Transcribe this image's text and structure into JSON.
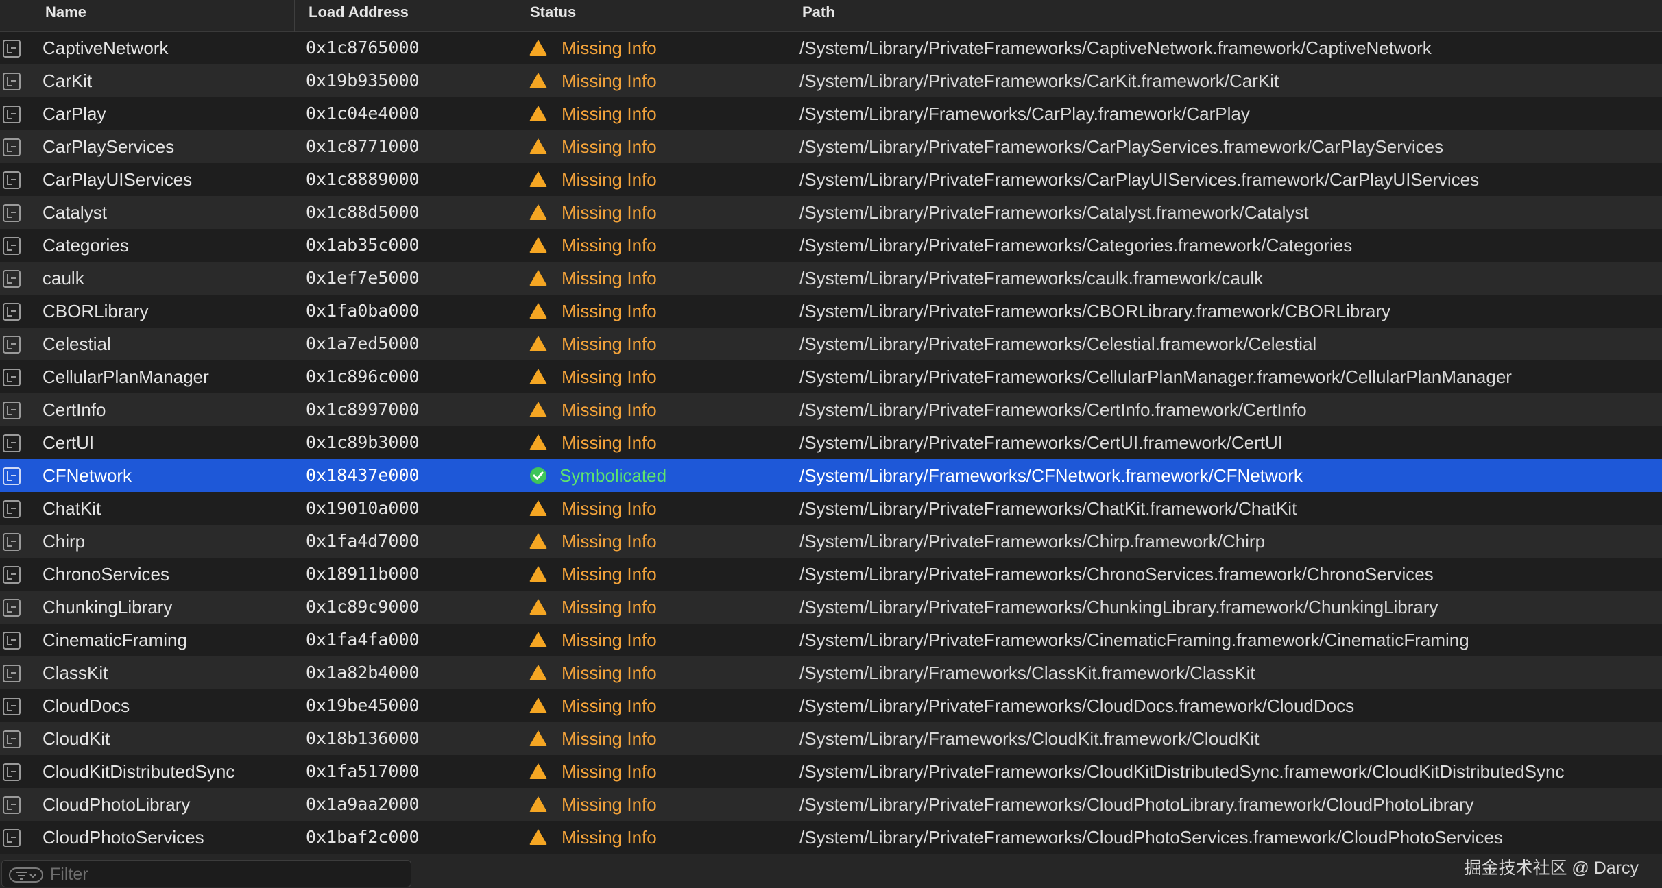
{
  "columns": {
    "name": "Name",
    "load_address": "Load Address",
    "status": "Status",
    "path": "Path"
  },
  "rows": [
    {
      "name": "CaptiveNetwork",
      "address": "0x1c8765000",
      "status": "Missing Info",
      "path": "/System/Library/PrivateFrameworks/CaptiveNetwork.framework/CaptiveNetwork"
    },
    {
      "name": "CarKit",
      "address": "0x19b935000",
      "status": "Missing Info",
      "path": "/System/Library/PrivateFrameworks/CarKit.framework/CarKit"
    },
    {
      "name": "CarPlay",
      "address": "0x1c04e4000",
      "status": "Missing Info",
      "path": "/System/Library/Frameworks/CarPlay.framework/CarPlay"
    },
    {
      "name": "CarPlayServices",
      "address": "0x1c8771000",
      "status": "Missing Info",
      "path": "/System/Library/PrivateFrameworks/CarPlayServices.framework/CarPlayServices"
    },
    {
      "name": "CarPlayUIServices",
      "address": "0x1c8889000",
      "status": "Missing Info",
      "path": "/System/Library/PrivateFrameworks/CarPlayUIServices.framework/CarPlayUIServices"
    },
    {
      "name": "Catalyst",
      "address": "0x1c88d5000",
      "status": "Missing Info",
      "path": "/System/Library/PrivateFrameworks/Catalyst.framework/Catalyst"
    },
    {
      "name": "Categories",
      "address": "0x1ab35c000",
      "status": "Missing Info",
      "path": "/System/Library/PrivateFrameworks/Categories.framework/Categories"
    },
    {
      "name": "caulk",
      "address": "0x1ef7e5000",
      "status": "Missing Info",
      "path": "/System/Library/PrivateFrameworks/caulk.framework/caulk"
    },
    {
      "name": "CBORLibrary",
      "address": "0x1fa0ba000",
      "status": "Missing Info",
      "path": "/System/Library/PrivateFrameworks/CBORLibrary.framework/CBORLibrary"
    },
    {
      "name": "Celestial",
      "address": "0x1a7ed5000",
      "status": "Missing Info",
      "path": "/System/Library/PrivateFrameworks/Celestial.framework/Celestial"
    },
    {
      "name": "CellularPlanManager",
      "address": "0x1c896c000",
      "status": "Missing Info",
      "path": "/System/Library/PrivateFrameworks/CellularPlanManager.framework/CellularPlanManager"
    },
    {
      "name": "CertInfo",
      "address": "0x1c8997000",
      "status": "Missing Info",
      "path": "/System/Library/PrivateFrameworks/CertInfo.framework/CertInfo"
    },
    {
      "name": "CertUI",
      "address": "0x1c89b3000",
      "status": "Missing Info",
      "path": "/System/Library/PrivateFrameworks/CertUI.framework/CertUI"
    },
    {
      "name": "CFNetwork",
      "address": "0x18437e000",
      "status": "Symbolicated",
      "path": "/System/Library/Frameworks/CFNetwork.framework/CFNetwork",
      "selected": true
    },
    {
      "name": "ChatKit",
      "address": "0x19010a000",
      "status": "Missing Info",
      "path": "/System/Library/PrivateFrameworks/ChatKit.framework/ChatKit"
    },
    {
      "name": "Chirp",
      "address": "0x1fa4d7000",
      "status": "Missing Info",
      "path": "/System/Library/PrivateFrameworks/Chirp.framework/Chirp"
    },
    {
      "name": "ChronoServices",
      "address": "0x18911b000",
      "status": "Missing Info",
      "path": "/System/Library/PrivateFrameworks/ChronoServices.framework/ChronoServices"
    },
    {
      "name": "ChunkingLibrary",
      "address": "0x1c89c9000",
      "status": "Missing Info",
      "path": "/System/Library/PrivateFrameworks/ChunkingLibrary.framework/ChunkingLibrary"
    },
    {
      "name": "CinematicFraming",
      "address": "0x1fa4fa000",
      "status": "Missing Info",
      "path": "/System/Library/PrivateFrameworks/CinematicFraming.framework/CinematicFraming"
    },
    {
      "name": "ClassKit",
      "address": "0x1a82b4000",
      "status": "Missing Info",
      "path": "/System/Library/Frameworks/ClassKit.framework/ClassKit"
    },
    {
      "name": "CloudDocs",
      "address": "0x19be45000",
      "status": "Missing Info",
      "path": "/System/Library/PrivateFrameworks/CloudDocs.framework/CloudDocs"
    },
    {
      "name": "CloudKit",
      "address": "0x18b136000",
      "status": "Missing Info",
      "path": "/System/Library/Frameworks/CloudKit.framework/CloudKit"
    },
    {
      "name": "CloudKitDistributedSync",
      "address": "0x1fa517000",
      "status": "Missing Info",
      "path": "/System/Library/PrivateFrameworks/CloudKitDistributedSync.framework/CloudKitDistributedSync"
    },
    {
      "name": "CloudPhotoLibrary",
      "address": "0x1a9aa2000",
      "status": "Missing Info",
      "path": "/System/Library/PrivateFrameworks/CloudPhotoLibrary.framework/CloudPhotoLibrary"
    },
    {
      "name": "CloudPhotoServices",
      "address": "0x1baf2c000",
      "status": "Missing Info",
      "path": "/System/Library/PrivateFrameworks/CloudPhotoServices.framework/CloudPhotoServices"
    }
  ],
  "icons": {
    "row_icon": "library-image-icon",
    "missing_status_icon": "warning-triangle-icon",
    "ok_status_icon": "checkmark-circle-icon",
    "filter_icon": "filter-icon"
  },
  "filter": {
    "placeholder": "Filter",
    "value": ""
  },
  "watermark": "掘金技术社区 @ Darcy",
  "colors": {
    "selection": "#1e58d8",
    "warning": "#f2a23a",
    "success": "#46d160",
    "row_alt": "#2a2a2a",
    "background": "#1e1e1e"
  }
}
